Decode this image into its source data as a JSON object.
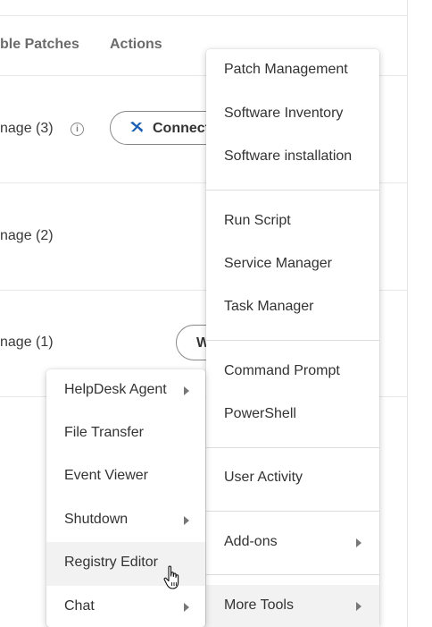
{
  "table": {
    "headers": {
      "patches": "ble Patches",
      "actions": "Actions"
    },
    "rows": [
      {
        "label": "nage  (3)"
      },
      {
        "label": "nage  (2)"
      },
      {
        "label": "nage  (1)"
      }
    ],
    "info_icon": "i",
    "connect_label": "Connect",
    "w_label": "W"
  },
  "main_menu": {
    "groups": [
      [
        "Patch Management",
        "Software Inventory",
        "Software installation"
      ],
      [
        "Run Script",
        "Service Manager",
        "Task Manager"
      ],
      [
        "Command Prompt",
        "PowerShell"
      ],
      [
        "User Activity"
      ],
      [
        "Add-ons"
      ],
      [
        "More Tools"
      ]
    ]
  },
  "sub_menu": {
    "items": [
      "HelpDesk Agent",
      "File Transfer",
      "Event Viewer",
      "Shutdown",
      "Registry Editor",
      "Chat"
    ]
  },
  "colors": {
    "accent_connect": "#1a5fb4",
    "menu_highlight": "#f2f2f2",
    "border": "#888888"
  }
}
